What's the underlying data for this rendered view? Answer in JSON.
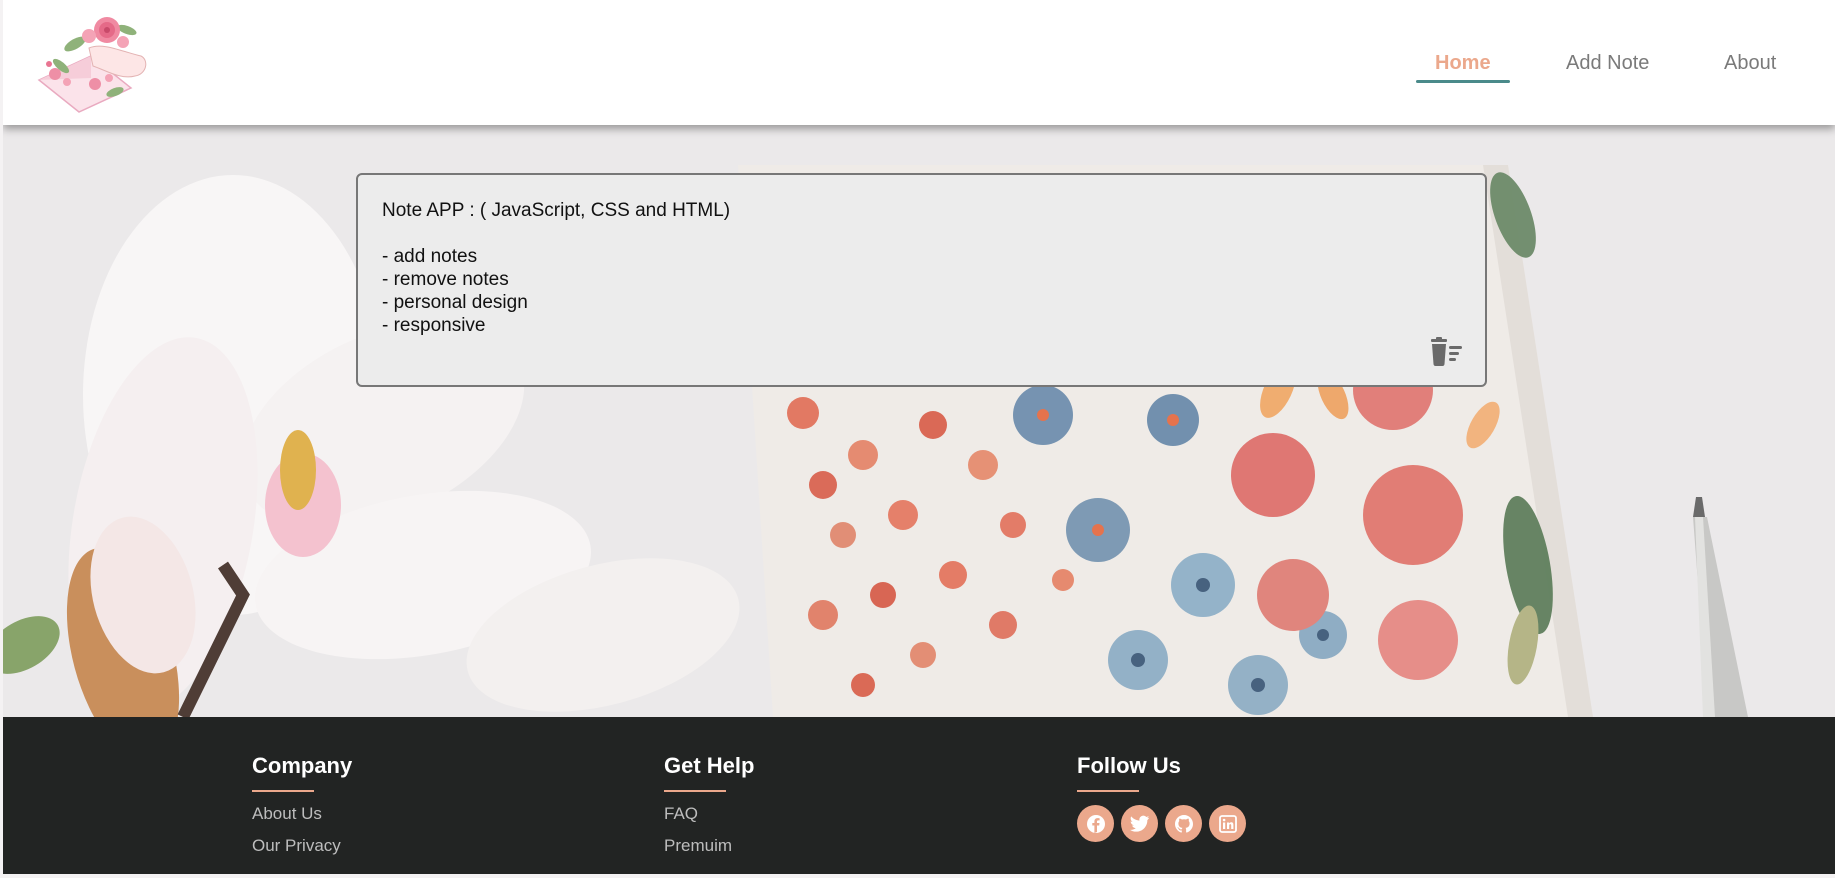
{
  "nav": {
    "items": [
      {
        "label": "Home",
        "active": true
      },
      {
        "label": "Add Note",
        "active": false
      },
      {
        "label": "About",
        "active": false
      }
    ]
  },
  "note": {
    "text": "Note APP : ( JavaScript, CSS and HTML)\n\n- add notes\n- remove notes\n- personal design\n- responsive",
    "delete_icon": "trash-icon"
  },
  "footer": {
    "company": {
      "title": "Company",
      "links": [
        "About Us",
        "Our Privacy"
      ]
    },
    "help": {
      "title": "Get Help",
      "links": [
        "FAQ",
        "Premuim"
      ]
    },
    "follow": {
      "title": "Follow Us",
      "icons": [
        "facebook-icon",
        "twitter-icon",
        "github-icon",
        "linkedin-icon"
      ]
    }
  },
  "colors": {
    "accent": "#eba88c",
    "nav_underline": "#4a8a8a",
    "footer_bg": "#222423",
    "note_bg": "#ececec"
  }
}
